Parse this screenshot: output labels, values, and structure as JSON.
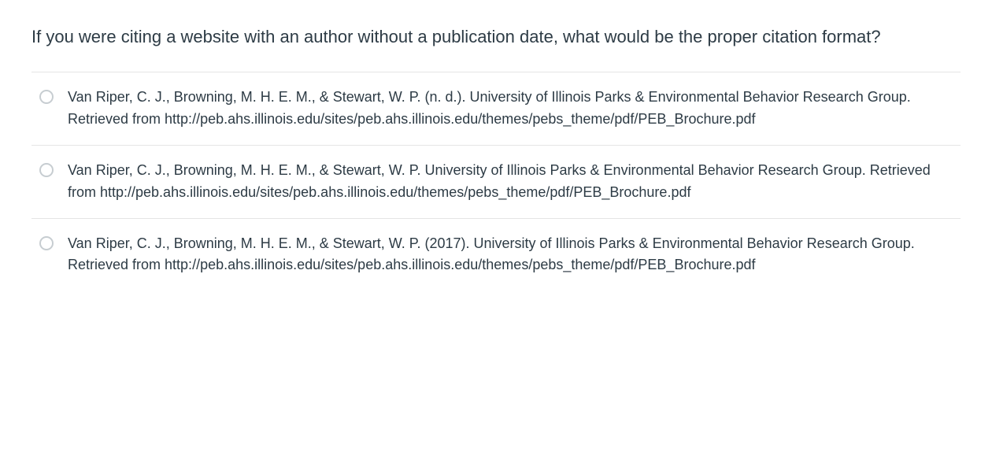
{
  "question": {
    "text": "If you were citing a website with an author without a publication date, what would be the proper citation format?"
  },
  "options": [
    {
      "text": "Van Riper, C. J., Browning, M. H. E. M., & Stewart, W. P. (n. d.). University of Illinois Parks & Environmental Behavior Research Group. Retrieved from http://peb.ahs.illinois.edu/sites/peb.ahs.illinois.edu/themes/pebs_theme/pdf/PEB_Brochure.pdf"
    },
    {
      "text": "Van Riper, C. J., Browning, M. H. E. M., & Stewart, W. P. University of Illinois Parks & Environmental Behavior Research Group. Retrieved from http://peb.ahs.illinois.edu/sites/peb.ahs.illinois.edu/themes/pebs_theme/pdf/PEB_Brochure.pdf"
    },
    {
      "text": "Van Riper, C. J., Browning, M. H. E. M., & Stewart, W. P. (2017). University of Illinois Parks & Environmental Behavior Research Group. Retrieved from http://peb.ahs.illinois.edu/sites/peb.ahs.illinois.edu/themes/pebs_theme/pdf/PEB_Brochure.pdf"
    }
  ]
}
